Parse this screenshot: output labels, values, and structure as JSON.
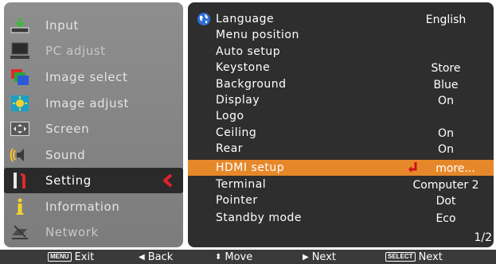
{
  "left_menu": {
    "items": [
      {
        "label": "Input",
        "icon": "input-icon"
      },
      {
        "label": "PC adjust",
        "icon": "pc-adjust-icon"
      },
      {
        "label": "Image select",
        "icon": "image-select-icon"
      },
      {
        "label": "Image adjust",
        "icon": "image-adjust-icon"
      },
      {
        "label": "Screen",
        "icon": "screen-icon"
      },
      {
        "label": "Sound",
        "icon": "sound-icon"
      },
      {
        "label": "Setting",
        "icon": "setting-icon",
        "selected": true
      },
      {
        "label": "Information",
        "icon": "information-icon"
      },
      {
        "label": "Network",
        "icon": "network-icon"
      }
    ]
  },
  "settings_menu": {
    "rows": [
      {
        "label": "Language",
        "value": "English"
      },
      {
        "label": "Menu position",
        "value": ""
      },
      {
        "label": "Auto setup",
        "value": ""
      },
      {
        "label": "Keystone",
        "value": "Store"
      },
      {
        "label": "Background",
        "value": "Blue"
      },
      {
        "label": "Display",
        "value": "On"
      },
      {
        "label": "Logo",
        "value": ""
      },
      {
        "label": "Ceiling",
        "value": "On"
      },
      {
        "label": "Rear",
        "value": "On"
      },
      {
        "label": "HDMI setup",
        "value": "more...",
        "highlighted": true
      },
      {
        "label": "Terminal",
        "value": "Computer 2"
      },
      {
        "label": "Pointer",
        "value": "Dot"
      },
      {
        "label": "Standby mode",
        "value": "Eco"
      }
    ],
    "page_indicator": "1/2"
  },
  "bottom_bar": {
    "menu_key": "MENU",
    "exit_label": "Exit",
    "back_label": "Back",
    "move_label": "Move",
    "next_label": "Next",
    "select_key": "SELECT",
    "select_next_label": "Next"
  },
  "colors": {
    "left_panel": "#8a8a8a",
    "right_panel": "#2e2e2e",
    "highlight": "#e6882a",
    "selection_arrow": "#e0212a"
  }
}
